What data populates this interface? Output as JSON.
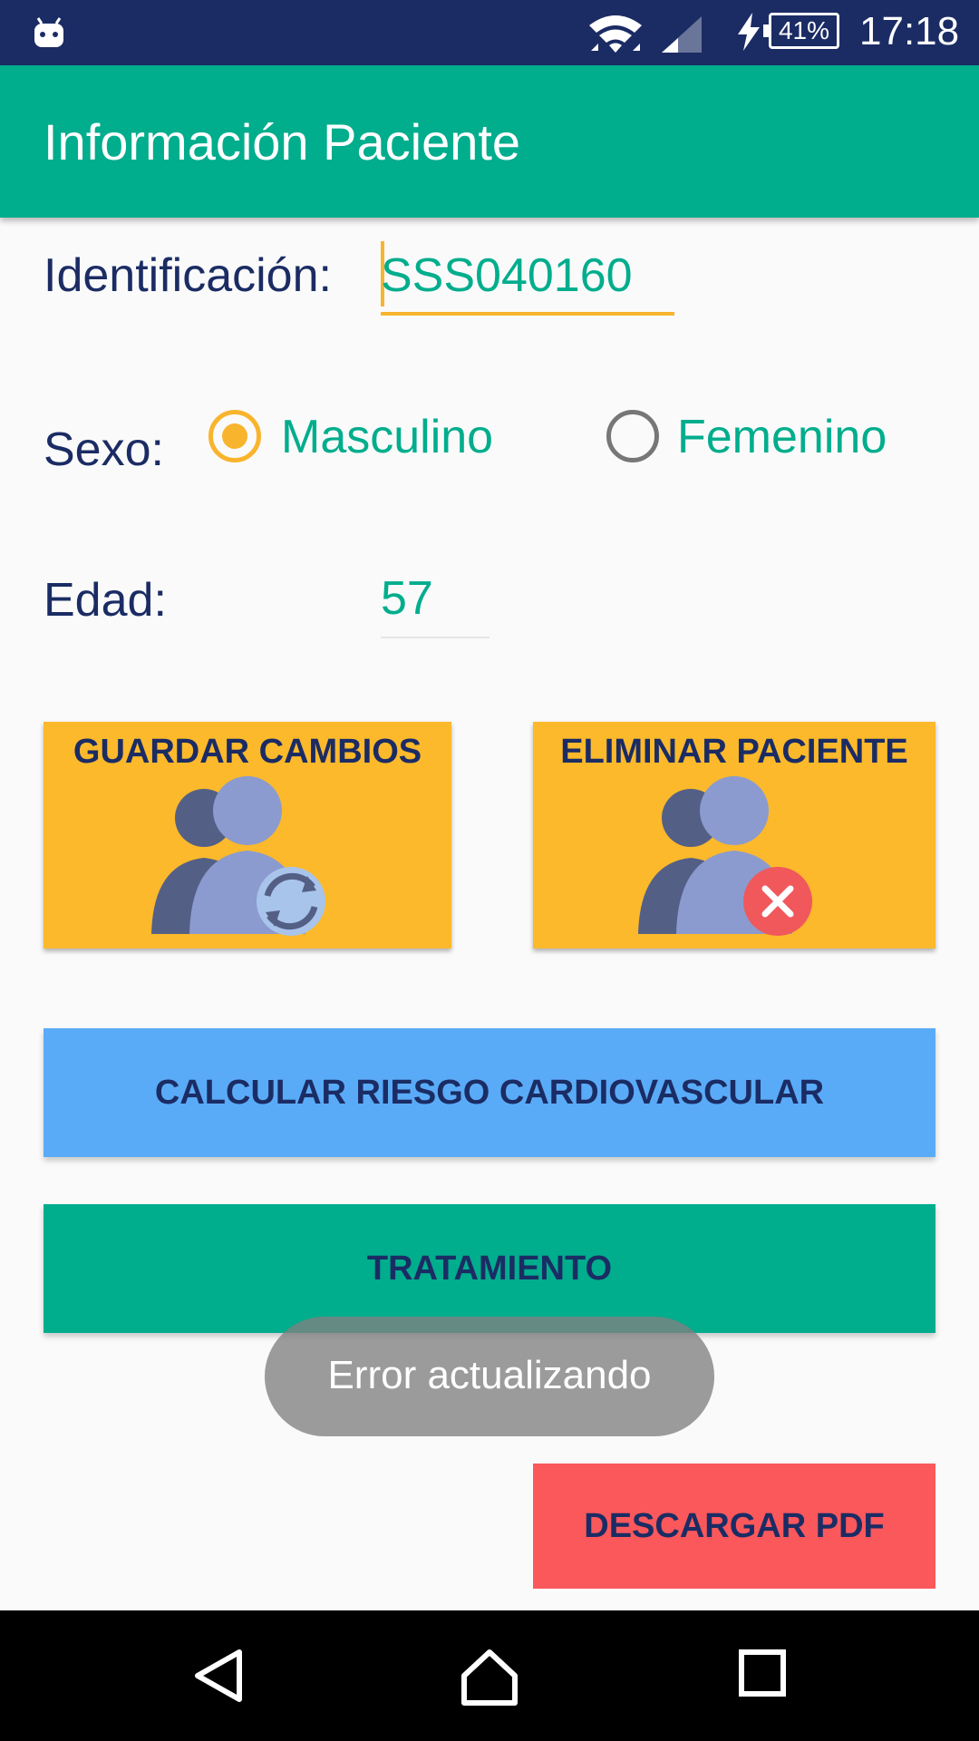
{
  "status_bar": {
    "battery": "41%",
    "time": "17:18",
    "icons": [
      "android-icon",
      "wifi-icon",
      "signal-icon",
      "charging-bolt-icon",
      "battery-icon"
    ]
  },
  "app_bar": {
    "title": "Información Paciente"
  },
  "form": {
    "id_label": "Identificación:",
    "id_value": "SSS040160",
    "sex_label": "Sexo:",
    "sex_options": [
      {
        "label": "Masculino",
        "selected": true
      },
      {
        "label": "Femenino",
        "selected": false
      }
    ],
    "age_label": "Edad:",
    "age_value": "57"
  },
  "buttons": {
    "save": "GUARDAR CAMBIOS",
    "delete": "ELIMINAR PACIENTE",
    "calc_risk": "CALCULAR RIESGO CARDIOVASCULAR",
    "treatment": "TRATAMIENTO",
    "download_pdf": "DESCARGAR PDF"
  },
  "toast": {
    "message": "Error actualizando"
  },
  "colors": {
    "status_bar": "#1b2c64",
    "primary": "#00ad8d",
    "accent": "#f9b42d",
    "tile": "#fbb92b",
    "calc_button": "#5aabf7",
    "pdf_button": "#fa585b",
    "text_dark": "#1b2c64"
  },
  "nav_bar": {
    "icons": [
      "back-icon",
      "home-icon",
      "recents-icon"
    ]
  }
}
